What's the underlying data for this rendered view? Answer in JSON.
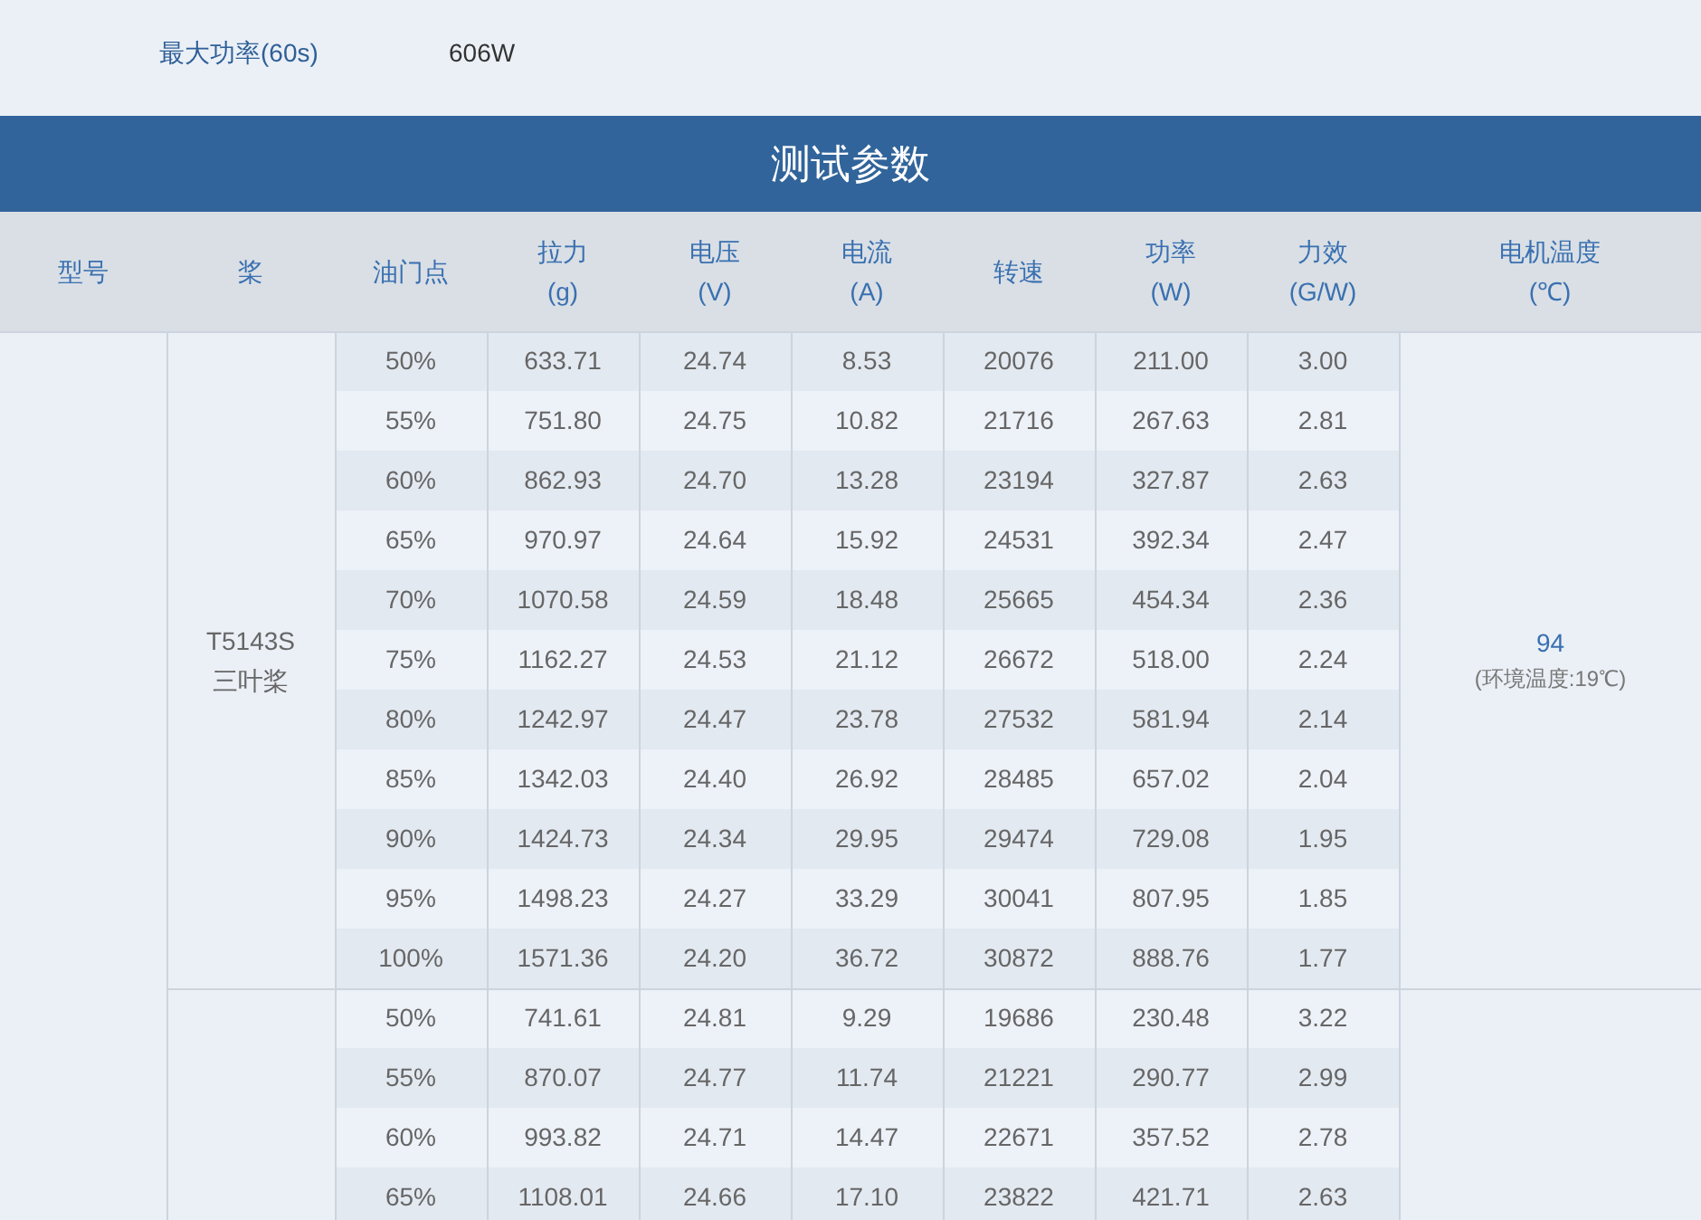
{
  "spec": {
    "label": "最大功率(60s)",
    "value": "606W"
  },
  "section_title": "测试参数",
  "columns": [
    {
      "label": "型号"
    },
    {
      "label": "桨"
    },
    {
      "label": "油门点"
    },
    {
      "label": "拉力",
      "unit": "(g)"
    },
    {
      "label": "电压",
      "unit": "(V)"
    },
    {
      "label": "电流",
      "unit": "(A)"
    },
    {
      "label": "转速"
    },
    {
      "label": "功率",
      "unit": "(W)"
    },
    {
      "label": "力效",
      "unit": "(G/W)"
    },
    {
      "label": "电机温度",
      "unit": "(℃)"
    }
  ],
  "groups": [
    {
      "prop": [
        "T5143S",
        "三叶桨"
      ],
      "temperature": {
        "value": "94",
        "ambient": "(环境温度:19℃)"
      },
      "rows": [
        [
          "50%",
          "633.71",
          "24.74",
          "8.53",
          "20076",
          "211.00",
          "3.00"
        ],
        [
          "55%",
          "751.80",
          "24.75",
          "10.82",
          "21716",
          "267.63",
          "2.81"
        ],
        [
          "60%",
          "862.93",
          "24.70",
          "13.28",
          "23194",
          "327.87",
          "2.63"
        ],
        [
          "65%",
          "970.97",
          "24.64",
          "15.92",
          "24531",
          "392.34",
          "2.47"
        ],
        [
          "70%",
          "1070.58",
          "24.59",
          "18.48",
          "25665",
          "454.34",
          "2.36"
        ],
        [
          "75%",
          "1162.27",
          "24.53",
          "21.12",
          "26672",
          "518.00",
          "2.24"
        ],
        [
          "80%",
          "1242.97",
          "24.47",
          "23.78",
          "27532",
          "581.94",
          "2.14"
        ],
        [
          "85%",
          "1342.03",
          "24.40",
          "26.92",
          "28485",
          "657.02",
          "2.04"
        ],
        [
          "90%",
          "1424.73",
          "24.34",
          "29.95",
          "29474",
          "729.08",
          "1.95"
        ],
        [
          "95%",
          "1498.23",
          "24.27",
          "33.29",
          "30041",
          "807.95",
          "1.85"
        ],
        [
          "100%",
          "1571.36",
          "24.20",
          "36.72",
          "30872",
          "888.76",
          "1.77"
        ]
      ]
    },
    {
      "rows": [
        [
          "50%",
          "741.61",
          "24.81",
          "9.29",
          "19686",
          "230.48",
          "3.22"
        ],
        [
          "55%",
          "870.07",
          "24.77",
          "11.74",
          "21221",
          "290.77",
          "2.99"
        ],
        [
          "60%",
          "993.82",
          "24.71",
          "14.47",
          "22671",
          "357.52",
          "2.78"
        ],
        [
          "65%",
          "1108.01",
          "24.66",
          "17.10",
          "23822",
          "421.71",
          "2.63"
        ]
      ]
    }
  ]
}
